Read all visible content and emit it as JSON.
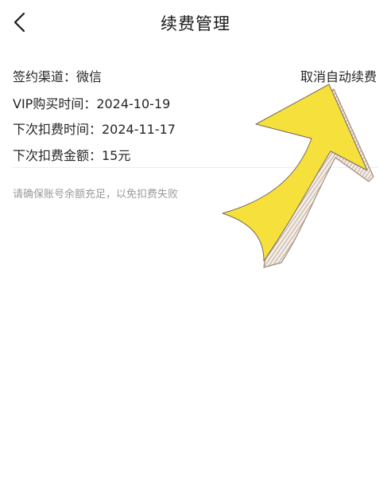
{
  "header": {
    "title": "续费管理",
    "back_icon": "chevron-left-icon"
  },
  "contract": {
    "channel": "签约渠道：微信",
    "vip_purchase_time": "VIP购买时间：2024-10-19",
    "next_charge_time": "下次扣费时间：2024-11-17",
    "next_charge_amount": "下次扣费金额：15元"
  },
  "actions": {
    "cancel_auto_renew": "取消自动续费"
  },
  "hint": "请确保账号余额充足，以免扣费失败",
  "annotation": {
    "icon": "curved-arrow-icon",
    "fill_color": "#f6e03c",
    "stroke_color": "#a58a78"
  }
}
